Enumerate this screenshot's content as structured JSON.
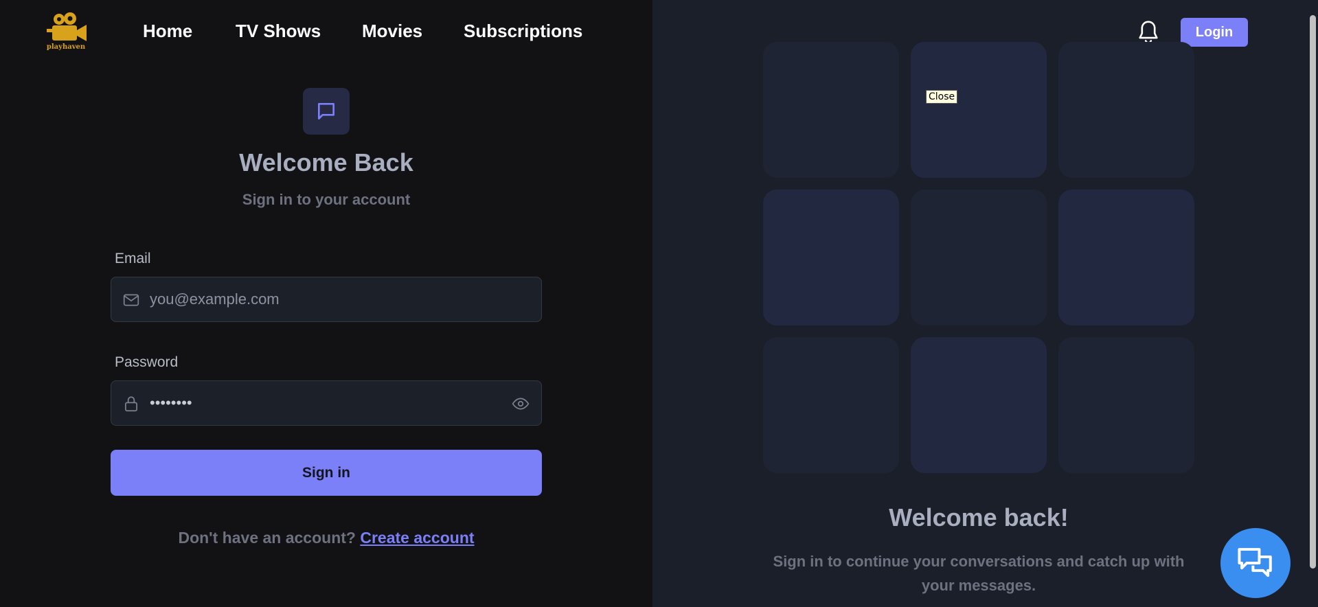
{
  "header": {
    "logo_text": "playhaven",
    "nav": [
      "Home",
      "TV Shows",
      "Movies",
      "Subscriptions"
    ],
    "login_label": "Login"
  },
  "form": {
    "title": "Welcome Back",
    "subtitle": "Sign in to your account",
    "email_label": "Email",
    "email_placeholder": "you@example.com",
    "password_label": "Password",
    "password_value": "••••••••",
    "submit_label": "Sign in",
    "footer_prompt": "Don't have an account?",
    "footer_link": "Create account"
  },
  "panel": {
    "tooltip": "Close",
    "title": "Welcome back!",
    "subtitle": "Sign in to continue your conversations and catch up with your messages."
  },
  "icons": {
    "logo": "movie-camera-icon",
    "bell": "bell-icon",
    "chat_badge": "chat-bubble-icon",
    "email": "mail-icon",
    "password": "lock-icon",
    "eye": "eye-icon",
    "fab": "chat-bubbles-icon"
  },
  "colors": {
    "accent": "#7b7ff8",
    "logo": "#d9a21b",
    "fab": "#3a8ef0"
  }
}
